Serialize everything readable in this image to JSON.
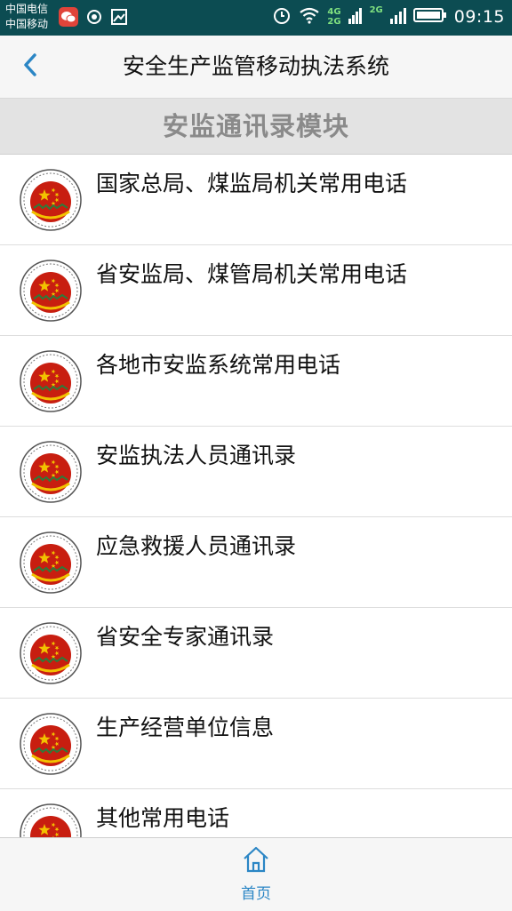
{
  "status_bar": {
    "carrier_1": "中国电信",
    "carrier_2": "中国移动",
    "network_1": "4G",
    "network_2": "2G",
    "network_3": "2G",
    "time": "09:15"
  },
  "header": {
    "title": "安全生产监管移动执法系统"
  },
  "section": {
    "title": "安监通讯录模块"
  },
  "list": {
    "items": [
      {
        "label": "国家总局、煤监局机关常用电话"
      },
      {
        "label": "省安监局、煤管局机关常用电话"
      },
      {
        "label": "各地市安监系统常用电话"
      },
      {
        "label": "安监执法人员通讯录"
      },
      {
        "label": "应急救援人员通讯录"
      },
      {
        "label": "省安全专家通讯录"
      },
      {
        "label": "生产经营单位信息"
      },
      {
        "label": "其他常用电话"
      }
    ]
  },
  "bottom_nav": {
    "home_label": "首页"
  },
  "colors": {
    "status_bar_bg": "#0c4c52",
    "accent": "#2b86c5",
    "emblem_red": "#c81e10",
    "emblem_gold": "#f2c200"
  },
  "icons": [
    "chevron-left-icon",
    "emblem-icon",
    "home-icon",
    "wifi-icon",
    "battery-icon",
    "alarm-icon",
    "signal-icon"
  ]
}
